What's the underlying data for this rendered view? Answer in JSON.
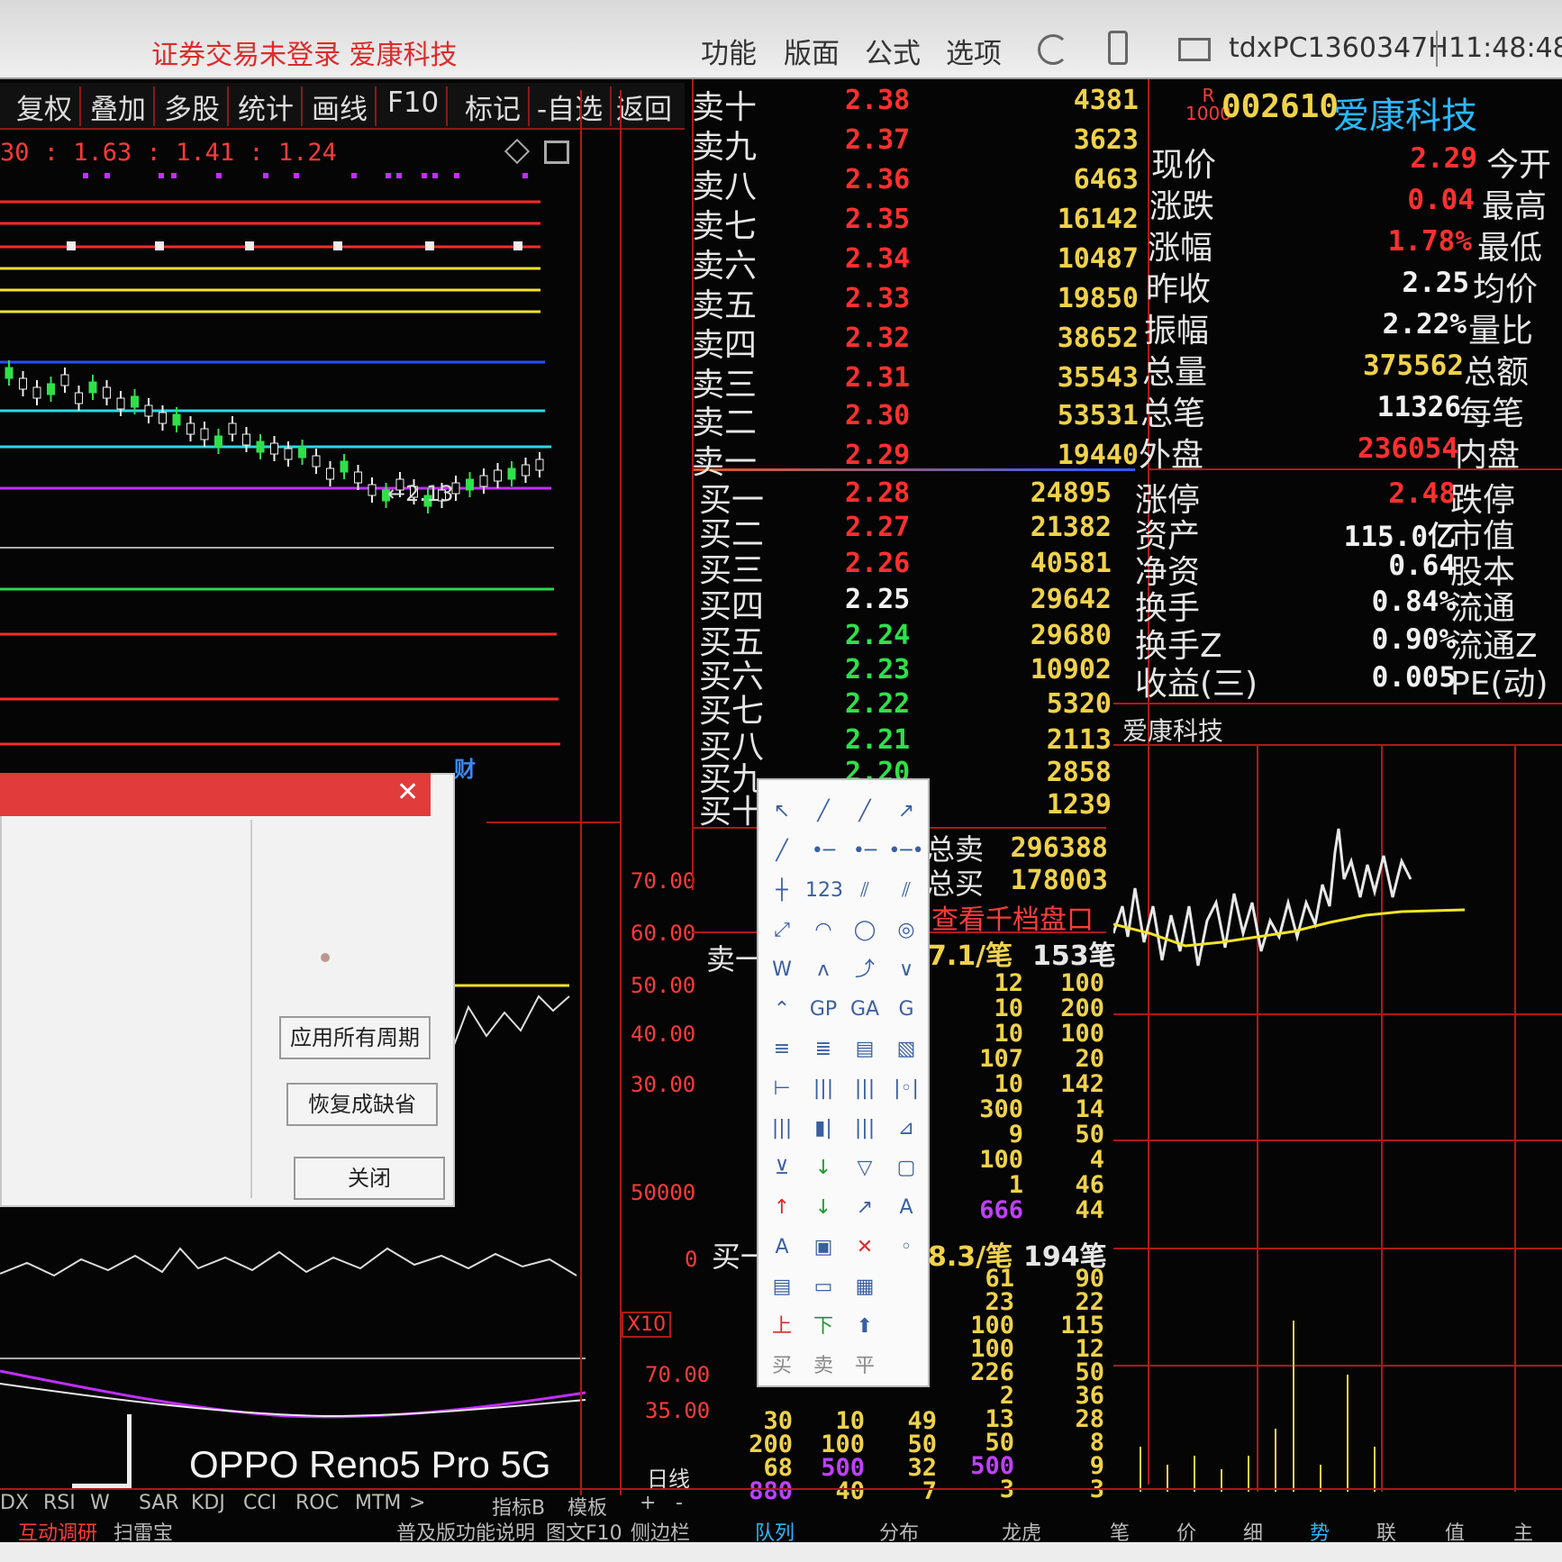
{
  "topbar": {
    "title": "证券交易未登录  爱康科技",
    "menu": [
      "功能",
      "版面",
      "公式",
      "选项"
    ],
    "connection": "tdxPC1360347H",
    "clock": "11:48:48"
  },
  "toolbar": {
    "items": [
      "复权",
      "叠加",
      "多股",
      "统计",
      "画线",
      "F10",
      "标记",
      "-自选",
      "返回"
    ]
  },
  "kchart": {
    "ma_text": "30 : 1.63 : 1.41 : 1.24",
    "low_label": "←2.13",
    "fin_badge": "财",
    "vol_axis": [
      "70.00",
      "60.00",
      "50.00",
      "40.00",
      "30.00"
    ],
    "mid_axis": [
      "50000",
      "0"
    ],
    "x10": "X10",
    "low_axis": [
      "70.00",
      "35.00"
    ],
    "period": "日线"
  },
  "orderbook": {
    "sell": [
      {
        "label": "卖十",
        "price": "2.38",
        "vol": "4381"
      },
      {
        "label": "卖九",
        "price": "2.37",
        "vol": "3623"
      },
      {
        "label": "卖八",
        "price": "2.36",
        "vol": "6463"
      },
      {
        "label": "卖七",
        "price": "2.35",
        "vol": "16142"
      },
      {
        "label": "卖六",
        "price": "2.34",
        "vol": "10487"
      },
      {
        "label": "卖五",
        "price": "2.33",
        "vol": "19850"
      },
      {
        "label": "卖四",
        "price": "2.32",
        "vol": "38652"
      },
      {
        "label": "卖三",
        "price": "2.31",
        "vol": "35543"
      },
      {
        "label": "卖二",
        "price": "2.30",
        "vol": "53531"
      },
      {
        "label": "卖一",
        "price": "2.29",
        "vol": "19440"
      }
    ],
    "buy": [
      {
        "label": "买一",
        "price": "2.28",
        "vol": "24895"
      },
      {
        "label": "买二",
        "price": "2.27",
        "vol": "21382"
      },
      {
        "label": "买三",
        "price": "2.26",
        "vol": "40581"
      },
      {
        "label": "买四",
        "price": "2.25",
        "vol": "29642"
      },
      {
        "label": "买五",
        "price": "2.24",
        "vol": "29680"
      },
      {
        "label": "买六",
        "price": "2.23",
        "vol": "10902"
      },
      {
        "label": "买七",
        "price": "2.22",
        "vol": "5320"
      },
      {
        "label": "买八",
        "price": "2.21",
        "vol": "2113"
      },
      {
        "label": "买九",
        "price": "2.20",
        "vol": "2858"
      },
      {
        "label": "买十",
        "price": "",
        "vol": "1239"
      }
    ],
    "total_sell_label": "总卖",
    "total_sell": "296388",
    "total_buy_label": "总买",
    "total_buy": "178003",
    "depth_link": "查看千档盘口",
    "sell_queue_head": "卖一",
    "sell_avg": "7.1/笔",
    "sell_count": "153笔",
    "buy_queue_head": "买一",
    "buy_avg": "8.3/笔",
    "buy_count": "194笔"
  },
  "quote": {
    "code": "002610",
    "name": "爱康科技",
    "left_labels": [
      "现价",
      "涨跌",
      "涨幅",
      "昨收",
      "振幅",
      "总量",
      "总笔",
      "外盘",
      "涨停",
      "资产",
      "净资",
      "换手",
      "换手Z",
      "收益(三)"
    ],
    "values": [
      "2.29",
      "0.04",
      "1.78%",
      "2.25",
      "2.22%",
      "375562",
      "11326",
      "236054",
      "2.48",
      "115.0亿",
      "0.64",
      "0.84%",
      "0.90%",
      "0.005"
    ],
    "right_labels": [
      "今开",
      "最高",
      "最低",
      "均价",
      "量比",
      "总额",
      "每笔",
      "内盘",
      "跌停",
      "市值",
      "股本",
      "流通",
      "流通Z",
      "PE(动)"
    ],
    "intraday_title": "爱康科技"
  },
  "dialog": {
    "btn_apply": "应用所有周期",
    "btn_restore": "恢复成缺省",
    "btn_close": "关闭"
  },
  "ticks": {
    "sell_rows": [
      [
        "12",
        "100"
      ],
      [
        "10",
        "200"
      ],
      [
        "10",
        "100"
      ],
      [
        "107",
        "20"
      ],
      [
        "10",
        "142"
      ],
      [
        "300",
        "14"
      ],
      [
        "9",
        "50"
      ],
      [
        "100",
        "4"
      ],
      [
        "1",
        "46"
      ],
      [
        "666",
        "44"
      ]
    ],
    "buy_rows": [
      [
        "61",
        "90"
      ],
      [
        "23",
        "22"
      ],
      [
        "100",
        "115"
      ],
      [
        "100",
        "12"
      ],
      [
        "226",
        "50"
      ],
      [
        "2",
        "36"
      ],
      [
        "13",
        "28"
      ],
      [
        "50",
        "8"
      ],
      [
        "500",
        "9"
      ],
      [
        "3",
        "3"
      ]
    ],
    "bottom_block": [
      [
        "30",
        "10",
        "49"
      ],
      [
        "200",
        "100",
        "50"
      ],
      [
        "68",
        "500",
        "32"
      ],
      [
        "880",
        "40",
        "7"
      ]
    ]
  },
  "bottom": {
    "indicators": [
      "DX",
      "RSI",
      "W",
      "SAR",
      "KDJ",
      "CCI",
      "ROC",
      "MTM",
      ">",
      "指标B",
      "模板",
      "+",
      "-"
    ],
    "tabs_left": [
      "互动调研",
      "扫雷宝"
    ],
    "tabs_mid": [
      "普及版功能说明",
      "图文F10",
      "侧边栏",
      "队列",
      "分布",
      "龙虎"
    ],
    "tabs_right": [
      "笔",
      "价",
      "细",
      "势",
      "联",
      "值",
      "主"
    ]
  },
  "watermark": {
    "text": "OPPO Reno5 Pro 5G"
  },
  "colors": {
    "up": "#ff3030",
    "down": "#2fe04a",
    "volume": "#f0d24a",
    "grid": "#b01818"
  }
}
